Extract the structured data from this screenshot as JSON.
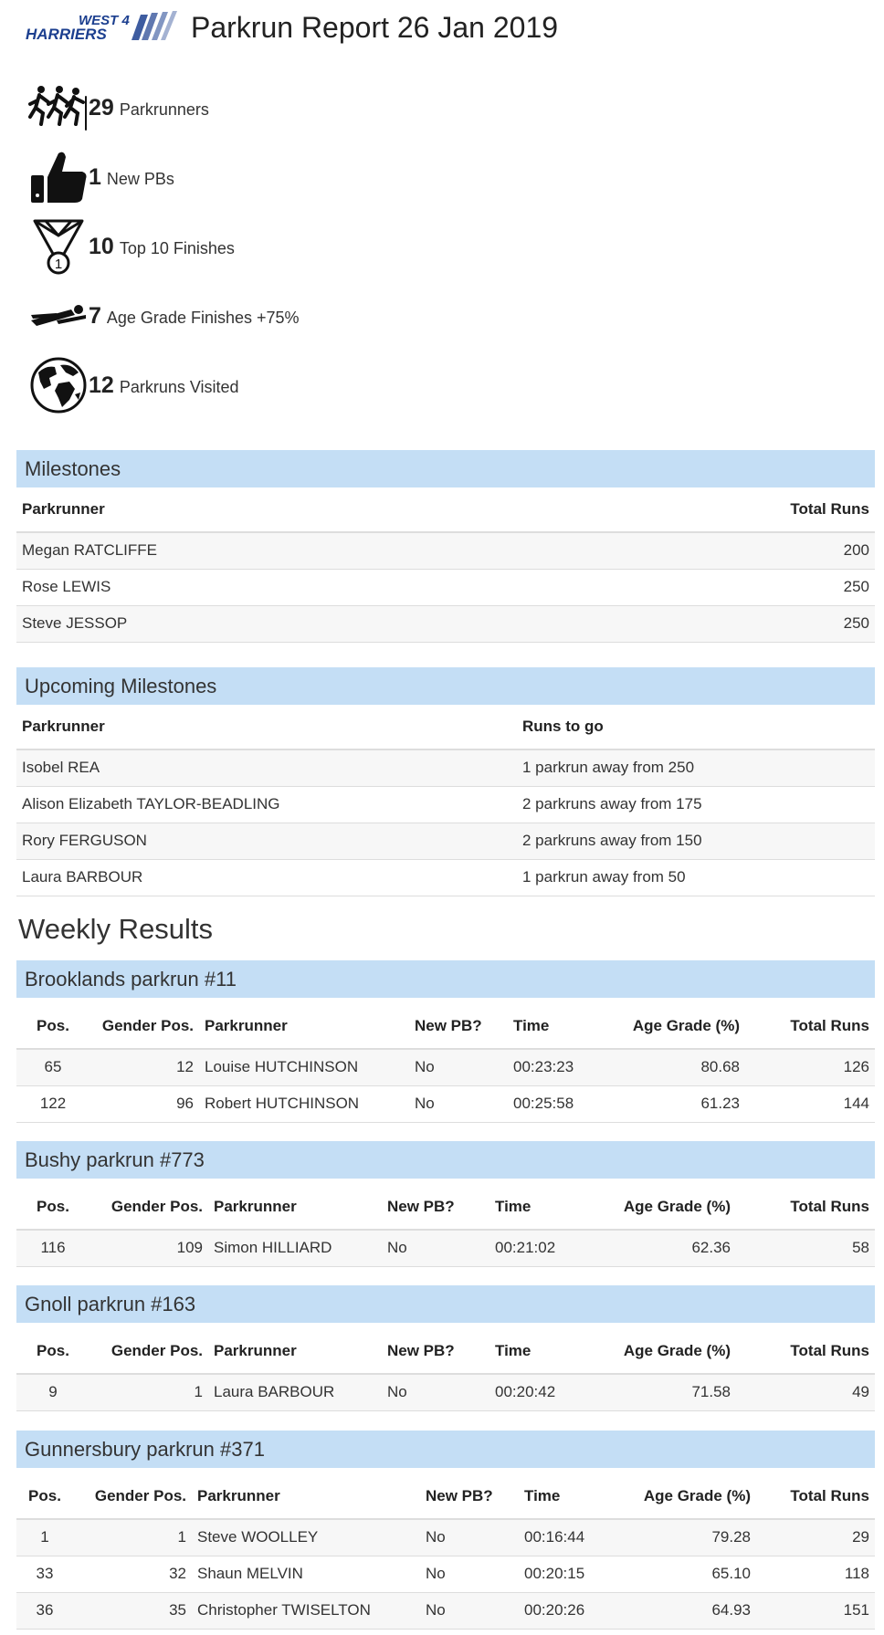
{
  "header": {
    "logo_text": "WEST 4 HARRIERS",
    "title": "Parkrun Report 26 Jan 2019"
  },
  "stats": [
    {
      "value": "29",
      "label": "Parkrunners",
      "icon": "runners-icon"
    },
    {
      "value": "1",
      "label": "New PBs",
      "icon": "thumbs-up-icon"
    },
    {
      "value": "10",
      "label": "Top 10 Finishes",
      "icon": "medal-icon"
    },
    {
      "value": "7",
      "label": "Age Grade Finishes +75%",
      "icon": "sprinter-icon"
    },
    {
      "value": "12",
      "label": "Parkruns Visited",
      "icon": "globe-icon"
    }
  ],
  "milestones": {
    "title": "Milestones",
    "columns": [
      "Parkrunner",
      "Total Runs"
    ],
    "rows": [
      [
        "Megan RATCLIFFE",
        "200"
      ],
      [
        "Rose LEWIS",
        "250"
      ],
      [
        "Steve JESSOP",
        "250"
      ]
    ]
  },
  "upcoming": {
    "title": "Upcoming Milestones",
    "columns": [
      "Parkrunner",
      "Runs to go"
    ],
    "rows": [
      [
        "Isobel REA",
        "1 parkrun away from 250"
      ],
      [
        "Alison Elizabeth TAYLOR-BEADLING",
        "2 parkruns away from 175"
      ],
      [
        "Rory FERGUSON",
        "2 parkruns away from 150"
      ],
      [
        "Laura BARBOUR",
        "1 parkrun away from 50"
      ]
    ]
  },
  "weekly_title": "Weekly Results",
  "result_columns": [
    "Pos.",
    "Gender Pos.",
    "Parkrunner",
    "New PB?",
    "Time",
    "Age Grade (%)",
    "Total Runs"
  ],
  "events": [
    {
      "title": "Brooklands parkrun #11",
      "rows": [
        [
          "65",
          "12",
          "Louise HUTCHINSON",
          "No",
          "00:23:23",
          "80.68",
          "126"
        ],
        [
          "122",
          "96",
          "Robert HUTCHINSON",
          "No",
          "00:25:58",
          "61.23",
          "144"
        ]
      ]
    },
    {
      "title": "Bushy parkrun #773",
      "rows": [
        [
          "116",
          "109",
          "Simon HILLIARD",
          "No",
          "00:21:02",
          "62.36",
          "58"
        ]
      ]
    },
    {
      "title": "Gnoll parkrun #163",
      "rows": [
        [
          "9",
          "1",
          "Laura BARBOUR",
          "No",
          "00:20:42",
          "71.58",
          "49"
        ]
      ]
    },
    {
      "title": "Gunnersbury parkrun #371",
      "rows": [
        [
          "1",
          "1",
          "Steve WOOLLEY",
          "No",
          "00:16:44",
          "79.28",
          "29"
        ],
        [
          "33",
          "32",
          "Shaun MELVIN",
          "No",
          "00:20:15",
          "65.10",
          "118"
        ],
        [
          "36",
          "35",
          "Christopher TWISELTON",
          "No",
          "00:20:26",
          "64.93",
          "151"
        ]
      ]
    }
  ]
}
